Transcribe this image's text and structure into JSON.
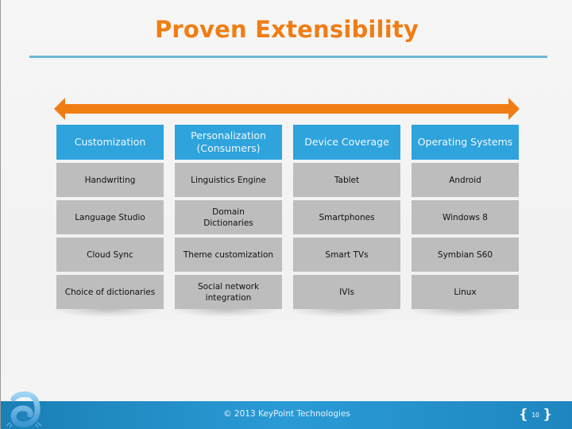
{
  "title": "Proven Extensibility",
  "colors": {
    "title": "#f07d14",
    "arrow": "#f07d14",
    "header_bg": "#2ea3dc",
    "cell_bg": "#bdbdbd",
    "footer_bg": "#2a9bd6",
    "rule": "#6cb8d8"
  },
  "arrow": {
    "direction": "bidirectional",
    "icon": "double-headed-arrow-icon"
  },
  "columns": [
    {
      "header": "Customization",
      "items": [
        "Handwriting",
        "Language Studio",
        "Cloud Sync",
        "Choice of dictionaries"
      ]
    },
    {
      "header": "Personalization (Consumers)",
      "items": [
        "Linguistics Engine",
        "Domain Dictionaries",
        "Theme customization",
        "Social network integration"
      ]
    },
    {
      "header": "Device Coverage",
      "items": [
        "Tablet",
        "Smartphones",
        "Smart TVs",
        "IVIs"
      ]
    },
    {
      "header": "Operating Systems",
      "items": [
        "Android",
        "Windows 8",
        "Symbian S60",
        "Linux"
      ]
    }
  ],
  "footer": {
    "copyright": "© 2013 KeyPoint Technologies",
    "page_number": "10",
    "logo_icon": "keypoint-frog-logo-icon"
  }
}
